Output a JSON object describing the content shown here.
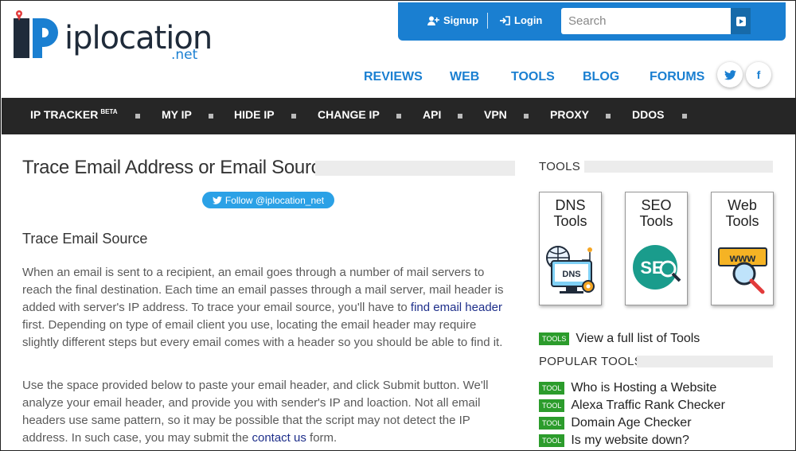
{
  "logo": {
    "name": "iplocation",
    "tld": ".net"
  },
  "topbar": {
    "signup": "Signup",
    "login": "Login",
    "search_placeholder": "Search"
  },
  "secondary_nav": [
    "REVIEWS",
    "WEB",
    "TOOLS",
    "BLOG",
    "FORUMS"
  ],
  "social": {
    "twitter": "t",
    "facebook": "f"
  },
  "main_nav": {
    "ip_tracker": "IP TRACKER",
    "beta": "BETA",
    "items": [
      "MY IP",
      "HIDE IP",
      "CHANGE IP",
      "API",
      "VPN",
      "PROXY",
      "DDOS"
    ]
  },
  "page": {
    "title": "Trace Email Address or Email Source",
    "follow": "Follow @iplocation_net",
    "subtitle": "Trace Email Source",
    "p1_before": "When an email is sent to a recipient, an email goes through a number of mail servers to reach the final destination. Each time an email passes through a mail server, mail header is added with server's IP address. To trace your email source, you'll have to ",
    "p1_link": "find email header",
    "p1_after": " first. Depending on type of email client you use, locating the email header may require slightly different steps but every email comes with a header so you should be able to find it.",
    "p2_before": "Use the space provided below to paste your email header, and click Submit button. We'll analyze your email header, and provide you with sender's IP and loaction. Not all email headers use same pattern, so it may be possible that the script may not detect the IP address. In such case, you may submit the ",
    "p2_link": "contact us",
    "p2_after": " form."
  },
  "sidebar": {
    "tools_heading": "TOOLS",
    "cards": [
      {
        "line1": "DNS",
        "line2": "Tools",
        "icon": "dns-server-icon"
      },
      {
        "line1": "SEO",
        "line2": "Tools",
        "icon": "seo-magnifier-icon"
      },
      {
        "line1": "Web",
        "line2": "Tools",
        "icon": "www-magnifier-icon"
      }
    ],
    "tools_tag": "TOOLS",
    "full_list": "View a full list of Tools",
    "popular_heading": "POPULAR TOOLS",
    "tool_tag": "TOOL",
    "popular": [
      "Who is Hosting a Website",
      "Alexa Traffic Rank Checker",
      "Domain Age Checker",
      "Is my website down?"
    ]
  },
  "colors": {
    "brand_blue": "#1a7fd1",
    "nav_dark": "#262626",
    "tag_green": "#2c9c2c",
    "link_dark": "#1d2e8a"
  }
}
